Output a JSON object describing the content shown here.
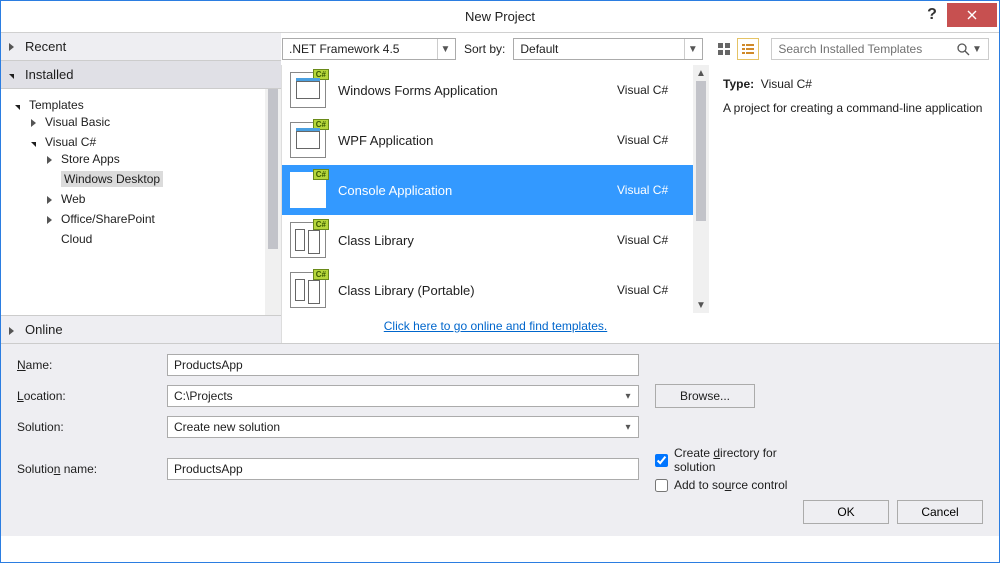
{
  "title": "New Project",
  "sidebar": {
    "recent_label": "Recent",
    "installed_label": "Installed",
    "online_label": "Online",
    "templates_label": "Templates",
    "tree": {
      "visual_basic": "Visual Basic",
      "visual_csharp": "Visual C#",
      "store_apps": "Store Apps",
      "windows_desktop": "Windows Desktop",
      "web": "Web",
      "office_sharepoint": "Office/SharePoint",
      "cloud": "Cloud"
    }
  },
  "toolbar": {
    "framework": ".NET Framework 4.5",
    "sort_label": "Sort by:",
    "sort_value": "Default",
    "search_placeholder": "Search Installed Templates"
  },
  "templates": [
    {
      "name": "Windows Forms Application",
      "lang": "Visual C#",
      "icon": "form"
    },
    {
      "name": "WPF Application",
      "lang": "Visual C#",
      "icon": "form"
    },
    {
      "name": "Console Application",
      "lang": "Visual C#",
      "icon": "console",
      "selected": true
    },
    {
      "name": "Class Library",
      "lang": "Visual C#",
      "icon": "lib"
    },
    {
      "name": "Class Library (Portable)",
      "lang": "Visual C#",
      "icon": "lib"
    }
  ],
  "online_link": "Click here to go online and find templates.",
  "description": {
    "type_label": "Type:",
    "type_value": "Visual C#",
    "text": "A project for creating a command-line application"
  },
  "form": {
    "name_label": "Name:",
    "name_value": "ProductsApp",
    "location_label": "Location:",
    "location_value": "C:\\Projects",
    "solution_label": "Solution:",
    "solution_value": "Create new solution",
    "solution_name_label": "Solution name:",
    "solution_name_value": "ProductsApp",
    "browse_label": "Browse...",
    "create_dir_label": "Create directory for solution",
    "create_dir_checked": true,
    "source_control_label": "Add to source control",
    "source_control_checked": false,
    "ok_label": "OK",
    "cancel_label": "Cancel"
  }
}
